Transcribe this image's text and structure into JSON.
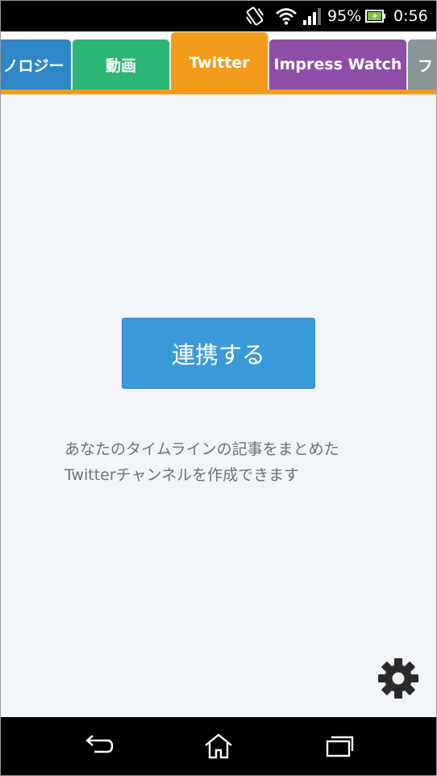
{
  "status_bar": {
    "battery_percent": "95%",
    "time": "0:56",
    "icons": [
      "vibrate-icon",
      "wifi-icon",
      "signal-icon",
      "battery-icon"
    ]
  },
  "tabs": [
    {
      "label": "ノロジー",
      "color": "#2f87c8"
    },
    {
      "label": "動画",
      "color": "#2bb673"
    },
    {
      "label": "Twitter",
      "color": "#f39b1a",
      "active": true
    },
    {
      "label": "Impress Watch",
      "color": "#8e4ea8"
    },
    {
      "label": "フ",
      "color": "#8b9496"
    }
  ],
  "main": {
    "connect_button_label": "連携する",
    "description_line1": "あなたのタイムラインの記事をまとめた",
    "description_line2": "Twitterチャンネルを作成できます"
  },
  "colors": {
    "accent": "#f39b1a",
    "button": "#3a9ad9",
    "background": "#f1f5f9"
  },
  "nav": {
    "icons": [
      "back-icon",
      "home-icon",
      "recent-apps-icon"
    ]
  }
}
